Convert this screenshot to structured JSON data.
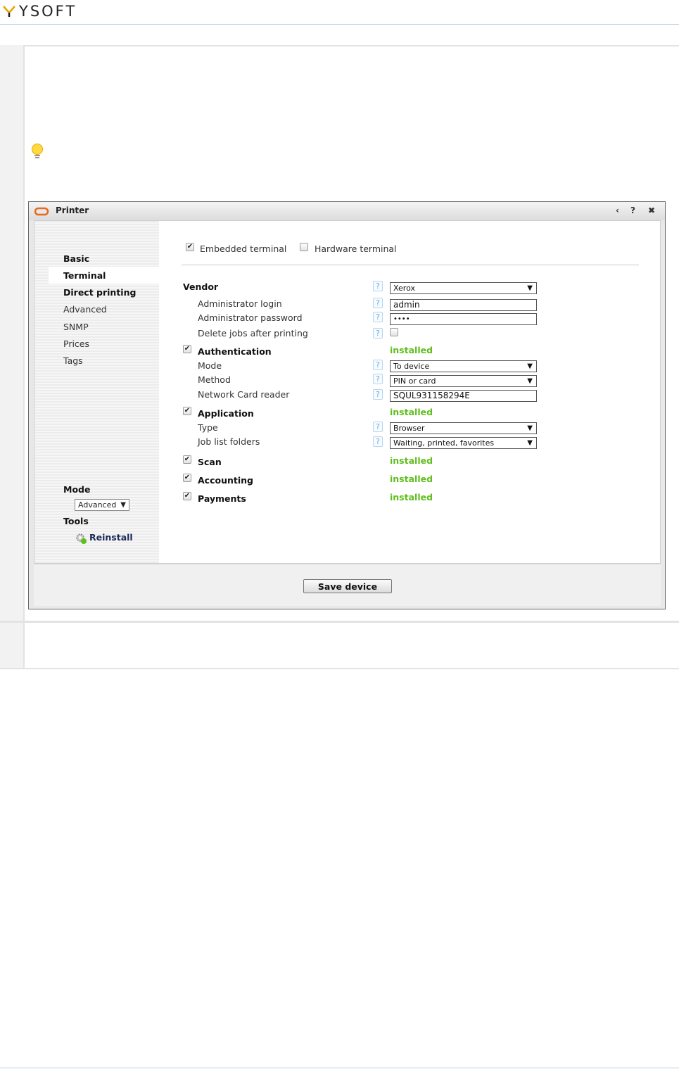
{
  "brand": {
    "logo_text": "YSOFT"
  },
  "dialog": {
    "title": "Printer",
    "controls": {
      "prev": "‹",
      "help": "?",
      "close": "✖"
    },
    "save_label": "Save device"
  },
  "sidebar": {
    "items": [
      {
        "label": "Basic"
      },
      {
        "label": "Terminal"
      },
      {
        "label": "Direct printing"
      },
      {
        "label": "Advanced"
      },
      {
        "label": "SNMP"
      },
      {
        "label": "Prices"
      },
      {
        "label": "Tags"
      }
    ],
    "mode_heading": "Mode",
    "mode_value": "Advanced",
    "tools_heading": "Tools",
    "reinstall_label": "Reinstall"
  },
  "terminal_type": {
    "embedded": {
      "label": "Embedded terminal",
      "checked": true
    },
    "hardware": {
      "label": "Hardware terminal",
      "checked": false
    }
  },
  "form": {
    "vendor": {
      "label": "Vendor",
      "value": "Xerox"
    },
    "admin_login": {
      "label": "Administrator login",
      "value": "admin"
    },
    "admin_password": {
      "label": "Administrator password",
      "value": "••••"
    },
    "delete_jobs": {
      "label": "Delete jobs after printing",
      "checked": false
    },
    "authentication": {
      "label": "Authentication",
      "status": "installed",
      "mode": {
        "label": "Mode",
        "value": "To device"
      },
      "method": {
        "label": "Method",
        "value": "PIN or card"
      },
      "reader": {
        "label": "Network Card reader",
        "value": "SQUL931158294E"
      }
    },
    "application": {
      "label": "Application",
      "status": "installed",
      "type": {
        "label": "Type",
        "value": "Browser"
      },
      "folders": {
        "label": "Job list folders",
        "value": "Waiting, printed, favorites"
      }
    },
    "scan": {
      "label": "Scan",
      "status": "installed"
    },
    "accounting": {
      "label": "Accounting",
      "status": "installed"
    },
    "payments": {
      "label": "Payments",
      "status": "installed"
    }
  },
  "icons": {
    "help": "?",
    "check": "✔",
    "select_arrow": "▼"
  },
  "colors": {
    "installed": "#5fbf1d",
    "help": "#6ea8dc",
    "brand_accent": "#e8a300"
  }
}
